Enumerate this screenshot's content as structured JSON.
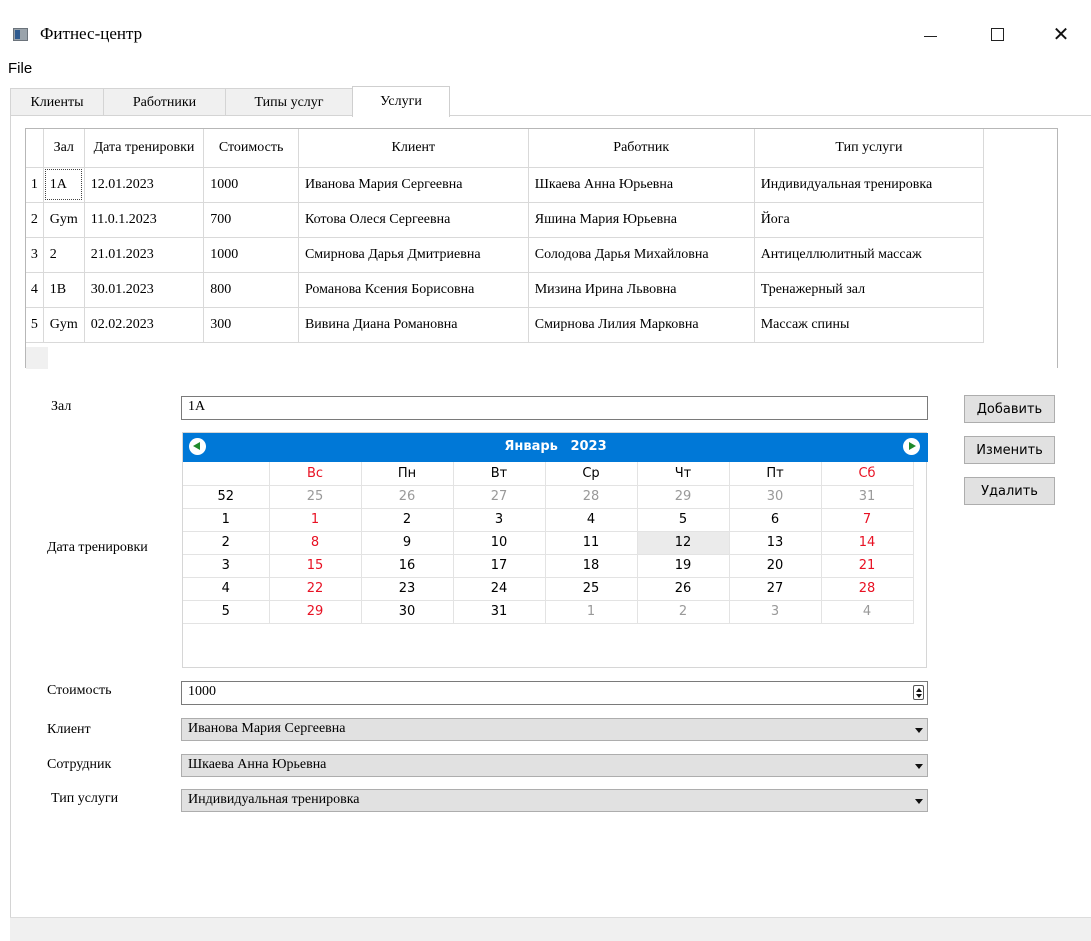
{
  "window": {
    "title": "Фитнес-центр",
    "minimize": "—",
    "maximize": "□",
    "close": "✕"
  },
  "menu": {
    "file": "File"
  },
  "tabs": [
    "Клиенты",
    "Работники",
    "Типы услуг",
    "Услуги"
  ],
  "active_tab": 3,
  "grid": {
    "columns": [
      "Зал",
      "Дата тренировки",
      "Стоимость",
      "Клиент",
      "Работник",
      "Тип услуги"
    ],
    "rows": [
      [
        "1",
        "1A",
        "12.01.2023",
        "1000",
        "Иванова Мария Сергеевна",
        "Шкаева Анна Юрьевна",
        "Индивидуальная тренировка"
      ],
      [
        "2",
        "Gym",
        "11.0.1.2023",
        "700",
        "Котова Олеся Сергеевна",
        "Яшина Мария Юрьевна",
        "Йога"
      ],
      [
        "3",
        "2",
        "21.01.2023",
        "1000",
        "Смирнова Дарья Дмитриевна",
        "Солодова Дарья Михайловна",
        "Антицеллюлитный массаж"
      ],
      [
        "4",
        "1B",
        "30.01.2023",
        "800",
        "Романова Ксения Борисовна",
        "Мизина Ирина Львовна",
        "Тренажерный зал"
      ],
      [
        "5",
        "Gym",
        "02.02.2023",
        "300",
        "Вивина Диана Романовна",
        "Смирнова Лилия Марковна",
        "Массаж  спины"
      ]
    ]
  },
  "form": {
    "zal_label": "Зал",
    "zal_value": "1A",
    "date_label": "Дата тренировки",
    "cost_label": "Стоимость",
    "cost_value": "1000",
    "client_label": "Клиент",
    "client_value": "Иванова Мария Сергеевна",
    "employee_label": "Сотрудник",
    "employee_value": "Шкаева Анна Юрьевна",
    "service_label": "Тип услуги",
    "service_value": "Индивидуальная тренировка"
  },
  "calendar": {
    "month": "Январь",
    "year": "2023",
    "weekdays": [
      "Вс",
      "Пн",
      "Вт",
      "Ср",
      "Чт",
      "Пт",
      "Сб"
    ],
    "weeks": [
      {
        "num": "52",
        "days": [
          "25",
          "26",
          "27",
          "28",
          "29",
          "30",
          "31"
        ],
        "other": [
          true,
          true,
          true,
          true,
          true,
          true,
          true
        ]
      },
      {
        "num": "1",
        "days": [
          "1",
          "2",
          "3",
          "4",
          "5",
          "6",
          "7"
        ],
        "other": [
          false,
          false,
          false,
          false,
          false,
          false,
          false
        ]
      },
      {
        "num": "2",
        "days": [
          "8",
          "9",
          "10",
          "11",
          "12",
          "13",
          "14"
        ],
        "other": [
          false,
          false,
          false,
          false,
          false,
          false,
          false
        ]
      },
      {
        "num": "3",
        "days": [
          "15",
          "16",
          "17",
          "18",
          "19",
          "20",
          "21"
        ],
        "other": [
          false,
          false,
          false,
          false,
          false,
          false,
          false
        ]
      },
      {
        "num": "4",
        "days": [
          "22",
          "23",
          "24",
          "25",
          "26",
          "27",
          "28"
        ],
        "other": [
          false,
          false,
          false,
          false,
          false,
          false,
          false
        ]
      },
      {
        "num": "5",
        "days": [
          "29",
          "30",
          "31",
          "1",
          "2",
          "3",
          "4"
        ],
        "other": [
          false,
          false,
          false,
          true,
          true,
          true,
          true
        ]
      }
    ],
    "selected_day": "12",
    "header_color": "#0078d7",
    "weekend_color": "#e81123"
  },
  "buttons": {
    "add": "Добавить",
    "edit": "Изменить",
    "delete": "Удалить"
  }
}
